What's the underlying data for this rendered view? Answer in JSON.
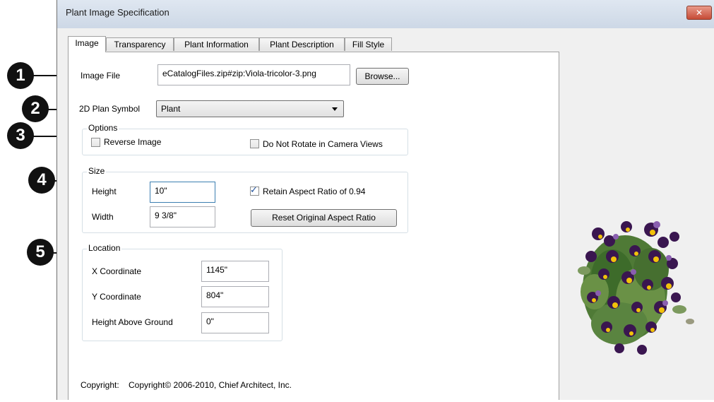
{
  "window": {
    "title": "Plant Image Specification",
    "close_symbol": "✕"
  },
  "tabs": [
    {
      "label": "Image",
      "active": true
    },
    {
      "label": "Transparency",
      "active": false
    },
    {
      "label": "Plant Information",
      "active": false
    },
    {
      "label": "Plant Description",
      "active": false
    },
    {
      "label": "Fill Style",
      "active": false
    }
  ],
  "image_file": {
    "label": "Image File",
    "value": "eCatalogFiles.zip#zip:Viola-tricolor-3.png",
    "browse_label": "Browse..."
  },
  "plan_symbol": {
    "label": "2D Plan Symbol",
    "value": "Plant"
  },
  "options": {
    "title": "Options",
    "reverse_image": {
      "label": "Reverse Image",
      "checked": false
    },
    "no_rotate": {
      "label": "Do Not Rotate in Camera Views",
      "checked": false
    }
  },
  "size": {
    "title": "Size",
    "height_label": "Height",
    "height_value": "10\"",
    "width_label": "Width",
    "width_value": "9 3/8\"",
    "retain_aspect": {
      "label": "Retain Aspect Ratio of 0.94",
      "checked": true
    },
    "reset_label": "Reset Original Aspect Ratio"
  },
  "location": {
    "title": "Location",
    "x_label": "X Coordinate",
    "x_value": "1145\"",
    "y_label": "Y Coordinate",
    "y_value": "804\"",
    "h_label": "Height Above Ground",
    "h_value": "0\""
  },
  "copyright": {
    "label": "Copyright:",
    "value": "Copyright© 2006-2010, Chief Architect, Inc."
  },
  "callouts": [
    "1",
    "2",
    "3",
    "4",
    "5"
  ],
  "preview_icon": "plant-image",
  "colors": {
    "accent_check": "#1c4f9c",
    "close_red": "#c64b36",
    "flower_purple": "#3a1650",
    "flower_yellow": "#f2c20a",
    "leaf_green": "#4f7a36"
  }
}
